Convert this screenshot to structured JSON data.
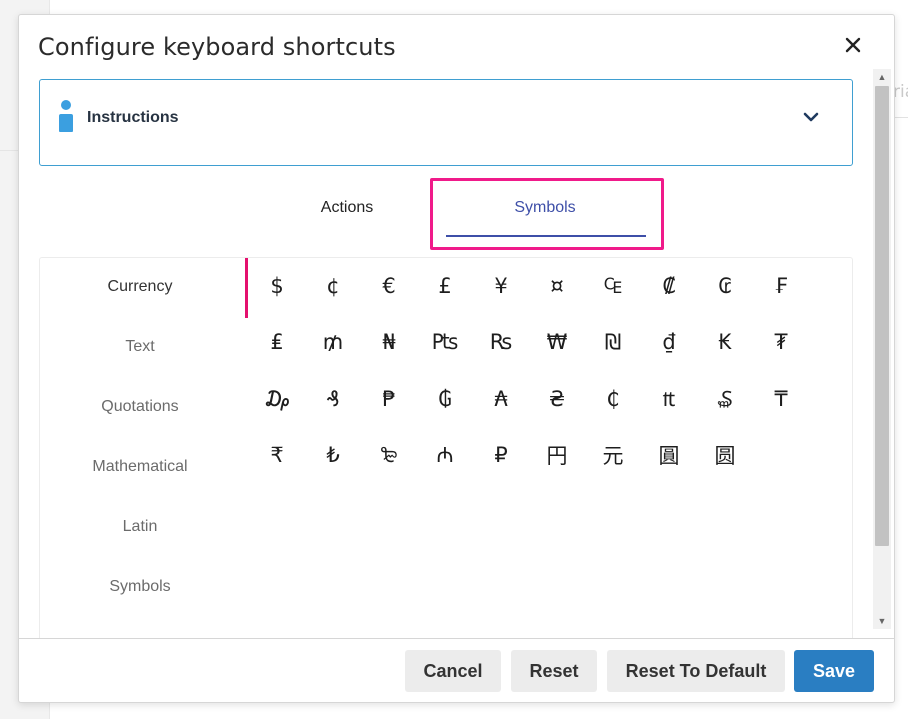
{
  "background": {
    "partial_text": "ria"
  },
  "dialog": {
    "title": "Configure keyboard shortcuts",
    "close_icon": "close-icon"
  },
  "instructions": {
    "label": "Instructions",
    "icon": "info-icon",
    "toggle_icon": "chevron-down-icon"
  },
  "tabs": [
    {
      "label": "Actions",
      "selected": false
    },
    {
      "label": "Symbols",
      "selected": true
    }
  ],
  "categories": [
    {
      "label": "Currency",
      "selected": true
    },
    {
      "label": "Text",
      "selected": false
    },
    {
      "label": "Quotations",
      "selected": false
    },
    {
      "label": "Mathematical",
      "selected": false
    },
    {
      "label": "Latin",
      "selected": false
    },
    {
      "label": "Symbols",
      "selected": false
    }
  ],
  "symbols": [
    [
      "$",
      "¢",
      "€",
      "£",
      "¥",
      "¤",
      "₠",
      "₡",
      "₢",
      "₣"
    ],
    [
      "₤",
      "₥",
      "₦",
      "₧",
      "₨",
      "₩",
      "₪",
      "₫",
      "₭",
      "₮"
    ],
    [
      "₯",
      "₰",
      "₱",
      "₲",
      "₳",
      "₴",
      "₵",
      "₶",
      "₷",
      "₸"
    ],
    [
      "₹",
      "₺",
      "₻",
      "₼",
      "₽",
      "円",
      "元",
      "圓",
      "圆"
    ]
  ],
  "footer": {
    "cancel": "Cancel",
    "reset": "Reset",
    "reset_default": "Reset To Default",
    "save": "Save"
  },
  "colors": {
    "accent": "#3e4fa8",
    "highlight": "#f01a8a",
    "category_indicator": "#e4106e",
    "info": "#3b9fe0",
    "save_button": "#2a7ec2"
  }
}
